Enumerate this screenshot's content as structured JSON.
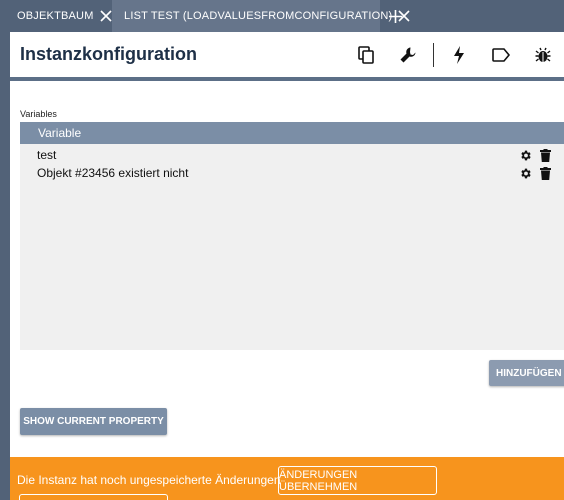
{
  "tabs": [
    {
      "label": "OBJEKTBAUM",
      "active": false
    },
    {
      "label": "LIST TEST (LOADVALUESFROMCONFIGURATION)",
      "active": true
    }
  ],
  "header": {
    "title": "Instanzkonfiguration",
    "icons": [
      "copy-icon",
      "wrench-icon",
      "lightning-icon",
      "tag-icon",
      "bug-icon"
    ]
  },
  "variables": {
    "label": "Variables",
    "column_header": "Variable",
    "rows": [
      {
        "text": "test"
      },
      {
        "text": "Objekt #23456 existiert nicht"
      }
    ]
  },
  "buttons": {
    "add": "HINZUFÜGEN",
    "show_property": "SHOW CURRENT PROPERTY"
  },
  "footer": {
    "message": "Die Instanz hat noch ungespeicherte Änderungen",
    "apply": "ÄNDERUNGEN ÜBERNEHMEN"
  },
  "colors": {
    "tabbar": "#526278",
    "accent": "#7b8ea6",
    "footer": "#f7941d"
  }
}
